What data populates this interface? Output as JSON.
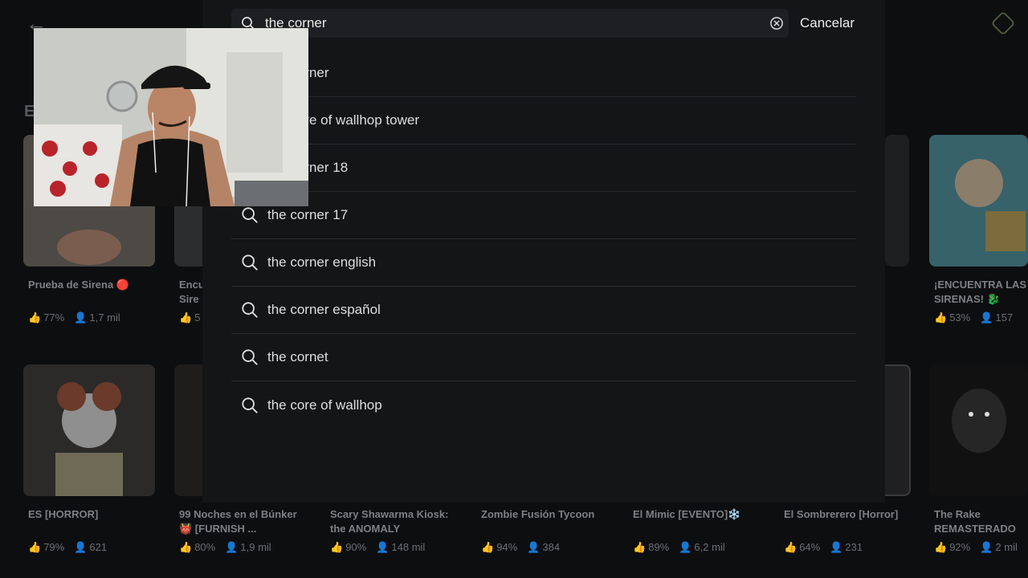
{
  "search": {
    "value": "the corner",
    "placeholder": ""
  },
  "cancel_label": "Cancelar",
  "section_letter": "E",
  "suggestions": [
    "the corner",
    "the core of wallhop tower",
    "the corner 18",
    "the corner 17",
    "the corner english",
    "the corner español",
    "the cornet",
    "the core of wallhop"
  ],
  "games_row1": [
    {
      "title": "Prueba de Sirena 🔴",
      "like": "77%",
      "players": "1,7 mil"
    },
    {
      "title": "Encu Sire",
      "like": "",
      "players": "5"
    },
    {
      "title": "¡ENCUENTRA LAS SIRENAS! 🐉",
      "like": "53%",
      "players": "157"
    }
  ],
  "games_row2": [
    {
      "title": "ES [HORROR]",
      "like": "79%",
      "players": "621"
    },
    {
      "title": "99 Noches en el Búnker👹 [FURNISH ...",
      "like": "80%",
      "players": "1,9 mil"
    },
    {
      "title": "Scary Shawarma Kiosk: the ANOMALY",
      "like": "90%",
      "players": "148 mil"
    },
    {
      "title": "Zombie Fusión Tycoon",
      "like": "94%",
      "players": "384"
    },
    {
      "title": "El Mimic [EVENTO]❄️",
      "like": "89%",
      "players": "6,2 mil"
    },
    {
      "title": "El Sombrerero [Horror]",
      "like": "64%",
      "players": "231"
    },
    {
      "title": "The Rake REMASTERADO",
      "like": "92%",
      "players": "2 mil"
    }
  ],
  "colors": {
    "panel_bg": "#141517",
    "page_bg": "#0d0e10",
    "text": "#dedede"
  }
}
